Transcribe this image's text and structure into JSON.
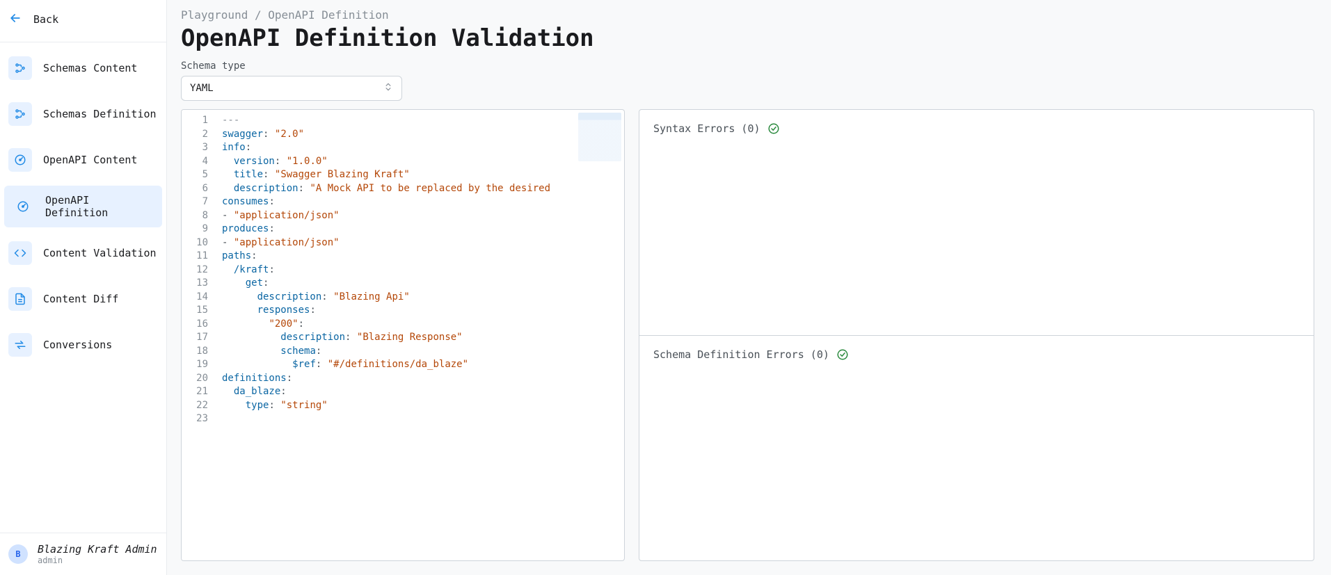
{
  "sidebar": {
    "back_label": "Back",
    "items": [
      {
        "label": "Schemas Content"
      },
      {
        "label": "Schemas Definition"
      },
      {
        "label": "OpenAPI Content"
      },
      {
        "label": "OpenAPI Definition"
      },
      {
        "label": "Content Validation"
      },
      {
        "label": "Content Diff"
      },
      {
        "label": "Conversions"
      }
    ]
  },
  "user": {
    "name": "Blazing Kraft Admin",
    "role": "admin",
    "initial": "B"
  },
  "breadcrumb": "Playground / OpenAPI Definition",
  "page_title": "OpenAPI Definition Validation",
  "schema_type": {
    "label": "Schema type",
    "value": "YAML"
  },
  "editor": {
    "line_count": 23,
    "lines": [
      {
        "raw": "---"
      },
      {
        "indent": 0,
        "key": "swagger",
        "value": "\"2.0\""
      },
      {
        "indent": 0,
        "key": "info",
        "value": ""
      },
      {
        "indent": 1,
        "key": "version",
        "value": "\"1.0.0\""
      },
      {
        "indent": 1,
        "key": "title",
        "value": "\"Swagger Blazing Kraft\""
      },
      {
        "indent": 1,
        "key": "description",
        "value": "\"A Mock API to be replaced by the desired"
      },
      {
        "indent": 0,
        "key": "consumes",
        "value": ""
      },
      {
        "indent": 0,
        "dash": true,
        "string": "\"application/json\""
      },
      {
        "indent": 0,
        "key": "produces",
        "value": ""
      },
      {
        "indent": 0,
        "dash": true,
        "string": "\"application/json\""
      },
      {
        "indent": 0,
        "key": "paths",
        "value": ""
      },
      {
        "indent": 1,
        "key": "/kraft",
        "value": ""
      },
      {
        "indent": 2,
        "key": "get",
        "value": ""
      },
      {
        "indent": 3,
        "key": "description",
        "value": "\"Blazing Api\""
      },
      {
        "indent": 3,
        "key": "responses",
        "value": ""
      },
      {
        "indent": 4,
        "keystring": "\"200\"",
        "value": ""
      },
      {
        "indent": 5,
        "key": "description",
        "value": "\"Blazing Response\""
      },
      {
        "indent": 5,
        "key": "schema",
        "value": ""
      },
      {
        "indent": 6,
        "key": "$ref",
        "value": "\"#/definitions/da_blaze\""
      },
      {
        "indent": 0,
        "key": "definitions",
        "value": ""
      },
      {
        "indent": 1,
        "key": "da_blaze",
        "value": ""
      },
      {
        "indent": 2,
        "key": "type",
        "value": "\"string\""
      },
      {
        "raw": ""
      }
    ]
  },
  "errors": {
    "syntax": {
      "label": "Syntax Errors",
      "count": 0
    },
    "schema": {
      "label": "Schema Definition Errors",
      "count": 0
    }
  },
  "colors": {
    "accent": "#228be6",
    "success": "#2b8a3e"
  }
}
